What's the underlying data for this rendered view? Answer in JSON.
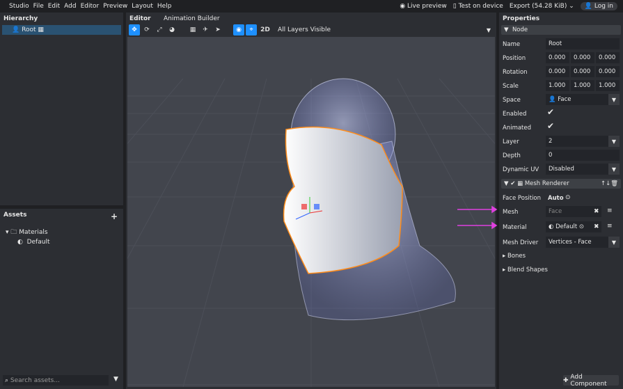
{
  "menu": [
    "Studio",
    "File",
    "Edit",
    "Add",
    "Editor",
    "Preview",
    "Layout",
    "Help"
  ],
  "top_right": {
    "live_preview": "Live preview",
    "test_device": "Test on device",
    "export": "Export (54.28 KiB)",
    "login": "Log in"
  },
  "hierarchy": {
    "title": "Hierarchy",
    "items": [
      {
        "label": "Root"
      }
    ]
  },
  "assets": {
    "title": "Assets",
    "folder": "Materials",
    "items": [
      "Default"
    ],
    "search_placeholder": "Search assets..."
  },
  "editor": {
    "tabs": [
      "Editor",
      "Animation Builder"
    ],
    "mode_2d": "2D",
    "layers": "All Layers Visible"
  },
  "properties": {
    "title": "Properties",
    "node_section": "Node",
    "name_label": "Name",
    "name": "Root",
    "position_label": "Position",
    "position": [
      "0.000",
      "0.000",
      "0.000"
    ],
    "rotation_label": "Rotation",
    "rotation": [
      "0.000",
      "0.000",
      "0.000"
    ],
    "scale_label": "Scale",
    "scale": [
      "1.000",
      "1.000",
      "1.000"
    ],
    "space_label": "Space",
    "space": "Face",
    "enabled_label": "Enabled",
    "animated_label": "Animated",
    "layer_label": "Layer",
    "layer": "2",
    "depth_label": "Depth",
    "depth": "0",
    "dynamic_uv_label": "Dynamic UV",
    "dynamic_uv": "Disabled",
    "mesh_renderer": "Mesh Renderer",
    "face_position_label": "Face Position",
    "face_position": "Auto",
    "mesh_label": "Mesh",
    "mesh_placeholder": "Face",
    "material_label": "Material",
    "material": "Default",
    "mesh_driver_label": "Mesh Driver",
    "mesh_driver": "Vertices - Face",
    "bones": "Bones",
    "blend_shapes": "Blend Shapes",
    "add_component": "Add Component"
  },
  "colors": {
    "accent": "#1e90ff",
    "arrow": "#e040e0",
    "outline": "#ff8c1a"
  }
}
